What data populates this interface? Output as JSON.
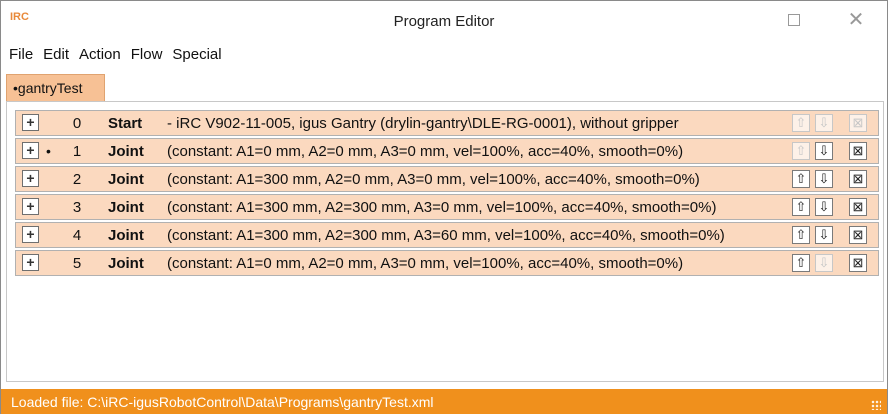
{
  "window": {
    "app_icon": "IRC",
    "title": "Program Editor",
    "maximize_icon": "maximize-icon",
    "close_icon": "close-icon"
  },
  "menu": [
    "File",
    "Edit",
    "Action",
    "Flow",
    "Special"
  ],
  "tab": {
    "label": "•gantryTest"
  },
  "rows": [
    {
      "dot": "",
      "num": "0",
      "type": "Start",
      "desc": "- iRC V902-11-005, igus Gantry (drylin-gantry\\DLE-RG-0001), without gripper",
      "up_enabled": false,
      "down_enabled": false,
      "delete_enabled": false
    },
    {
      "dot": "•",
      "num": "1",
      "type": "Joint",
      "desc": "(constant: A1=0 mm, A2=0 mm, A3=0 mm, vel=100%, acc=40%, smooth=0%)",
      "up_enabled": false,
      "down_enabled": true,
      "delete_enabled": true
    },
    {
      "dot": "",
      "num": "2",
      "type": "Joint",
      "desc": "(constant: A1=300 mm, A2=0 mm, A3=0 mm, vel=100%, acc=40%, smooth=0%)",
      "up_enabled": true,
      "down_enabled": true,
      "delete_enabled": true
    },
    {
      "dot": "",
      "num": "3",
      "type": "Joint",
      "desc": "(constant: A1=300 mm, A2=300 mm, A3=0 mm, vel=100%, acc=40%, smooth=0%)",
      "up_enabled": true,
      "down_enabled": true,
      "delete_enabled": true
    },
    {
      "dot": "",
      "num": "4",
      "type": "Joint",
      "desc": "(constant: A1=300 mm, A2=300 mm, A3=60 mm, vel=100%, acc=40%, smooth=0%)",
      "up_enabled": true,
      "down_enabled": true,
      "delete_enabled": true
    },
    {
      "dot": "",
      "num": "5",
      "type": "Joint",
      "desc": "(constant: A1=0 mm, A2=0 mm, A3=0 mm, vel=100%, acc=40%, smooth=0%)",
      "up_enabled": true,
      "down_enabled": false,
      "delete_enabled": true
    }
  ],
  "row_icons": {
    "add": "add-icon",
    "up": "arrow-up-icon",
    "down": "arrow-down-icon",
    "delete": "delete-icon"
  },
  "status": {
    "text": "Loaded file: C:\\iRC-igusRobotControl\\Data\\Programs\\gantryTest.xml"
  },
  "colors": {
    "row_background": "#fbd9bf",
    "tab_background": "#f7c195",
    "statusbar": "#f0901c"
  }
}
